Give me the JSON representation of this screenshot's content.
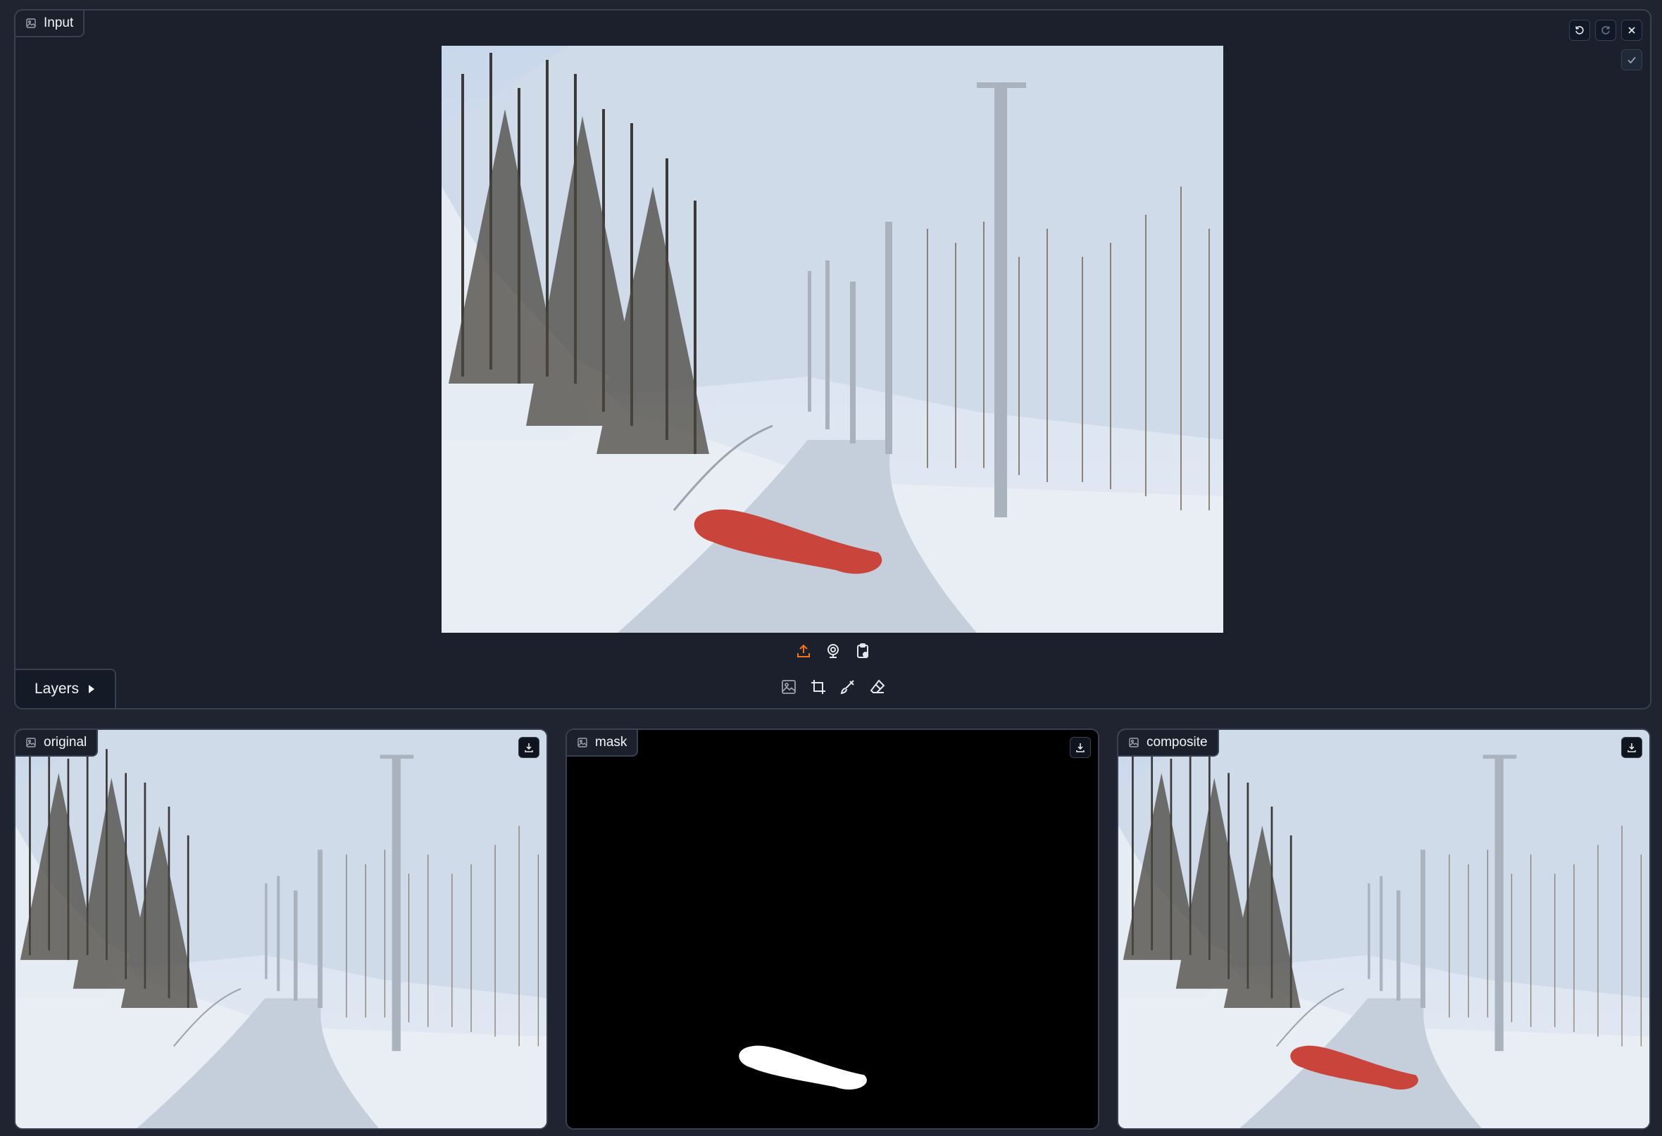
{
  "input": {
    "label": "Input",
    "icon": "image-icon",
    "toolbar": [
      "undo-icon",
      "redo-icon",
      "close-icon"
    ],
    "confirm_icon": "check-icon",
    "layers_label": "Layers",
    "source_buttons": [
      "upload-icon",
      "webcam-icon",
      "clipboard-icon"
    ],
    "tools": [
      "image-icon",
      "crop-icon",
      "brush-icon",
      "eraser-icon"
    ]
  },
  "outputs": {
    "original": {
      "label": "original"
    },
    "mask": {
      "label": "mask"
    },
    "composite": {
      "label": "composite"
    }
  },
  "colors": {
    "background": "#1f2430",
    "panel": "#1b202c",
    "border": "#374151",
    "accent_upload": "#f97316",
    "brush_stroke": "#c9443a"
  }
}
